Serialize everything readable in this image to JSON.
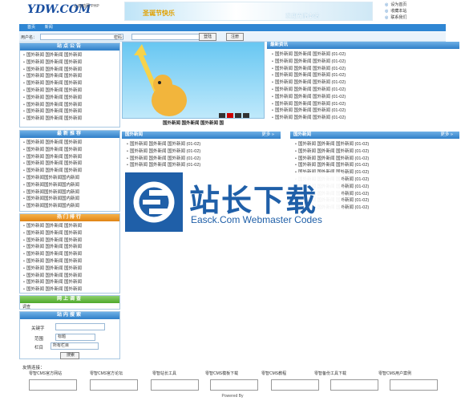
{
  "header": {
    "logo_main": "YDW.COM",
    "logo_sub": "心雨动网 PHP",
    "banner_text": "圣诞节快乐",
    "banner_sub": "欢迎光临本站",
    "links": [
      "设为首页",
      "收藏本站",
      "联系我们"
    ]
  },
  "nav": {
    "items": [
      "首页",
      "新闻"
    ]
  },
  "login": {
    "user_label": "用户名：",
    "pass_label": "密码：",
    "login_btn": "登陆",
    "register_btn": "注册"
  },
  "left": {
    "announce_title": "站点公告",
    "announce_items": [
      "国外新闻 国外新闻 国外新闻",
      "国外新闻 国外新闻 国外新闻",
      "国外新闻 国外新闻 国外新闻",
      "国外新闻 国外新闻 国外新闻",
      "国外新闻 国外新闻 国外新闻",
      "国外新闻 国外新闻 国外新闻",
      "国外新闻 国外新闻 国外新闻",
      "国外新闻 国外新闻 国外新闻",
      "国外新闻 国外新闻 国外新闻",
      "国外新闻 国外新闻 国外新闻"
    ],
    "recommend_title": "最新推荐",
    "recommend_items": [
      "国外新闻 国外新闻 国外新闻",
      "国外新闻 国外新闻 国外新闻",
      "国外新闻 国外新闻 国外新闻",
      "国外新闻 国外新闻 国外新闻",
      "国外新闻 国外新闻 国外新闻",
      "国外新闻国外新闻国内新闻",
      "国外新闻国外新闻国内新闻",
      "国外新闻国外新闻国内新闻",
      "国外新闻国外新闻国内新闻",
      "国外新闻国外新闻国内新闻"
    ],
    "hot_title": "热门排行",
    "hot_items": [
      "国外新闻 国外新闻 国外新闻",
      "国外新闻 国外新闻 国外新闻",
      "国外新闻 国外新闻 国外新闻",
      "国外新闻 国外新闻 国外新闻",
      "国外新闻 国外新闻 国外新闻",
      "国外新闻 国外新闻 国外新闻",
      "国外新闻 国外新闻 国外新闻",
      "国外新闻 国外新闻 国外新闻",
      "国外新闻 国外新闻 国外新闻",
      "国外新闻 国外新闻 国外新闻"
    ],
    "online_title": "网上调查",
    "online_text": "调查",
    "search_title": "站内搜索",
    "keyword_label": "关键字",
    "range_label": "范围",
    "range_value": "标题",
    "column_label": "栏目",
    "column_value": "所有栏目",
    "search_btn": "搜索"
  },
  "flash": {
    "caption": "国外新闻 国外新闻 国外新闻 国"
  },
  "latest": {
    "title": "最新资讯",
    "items": [
      "国外新闻 国外新闻 国外新闻 (01-02)",
      "国外新闻 国外新闻 国外新闻 (01-02)",
      "国外新闻 国外新闻 国外新闻 (01-02)",
      "国外新闻 国外新闻 国外新闻 (01-02)",
      "国外新闻 国外新闻 国外新闻 (01-02)",
      "国外新闻 国外新闻 国外新闻 (01-02)",
      "国外新闻 国外新闻 国外新闻 (01-02)",
      "国外新闻 国外新闻 国外新闻 (01-02)",
      "国外新闻 国外新闻 国外新闻 (01-02)",
      "国外新闻 国外新闻 国外新闻 (01-02)"
    ]
  },
  "panel_a": {
    "title": "国外新闻",
    "more": "更多 »",
    "items": [
      "国外新闻 国外新闻 国外新闻 (01-02)",
      "国外新闻 国外新闻 国外新闻 (01-02)",
      "国外新闻 国外新闻 国外新闻 (01-02)",
      "国外新闻 国外新闻 国外新闻 (01-02)"
    ]
  },
  "panel_b": {
    "title": "国外新闻",
    "more": "更多 »",
    "items": [
      "国外新闻 国外新闻 国外新闻 (01-02)",
      "国外新闻 国外新闻 国外新闻 (01-02)",
      "国外新闻 国外新闻 国外新闻 (01-02)",
      "国外新闻 国外新闻 国外新闻 (01-02)",
      "国外新闻 国外新闻 国外新闻 (01-02)",
      "国外新闻 国外新闻 国外新闻 (01-02)",
      "国外新闻 国外新闻 国外新闻 (01-02)",
      "国外新闻 国外新闻 国外新闻 (01-02)",
      "国外新闻 国外新闻 国外新闻 (01-02)",
      "国外新闻 国外新闻 国外新闻 (01-02)"
    ]
  },
  "watermark": {
    "title": "站长下载",
    "subtitle": "Easck.Com Webmaster Codes"
  },
  "friends": {
    "label": "友情连接：",
    "links": [
      "零智CMS官方网站",
      "零智CMS官方论坛",
      "零智站长工具",
      "零智CMS模板下载",
      "零智CMS教程",
      "零智备份工具下载",
      "零智CMS用户案例"
    ]
  },
  "footer": {
    "text": "Powered By"
  },
  "colors": {
    "nav_blue": "#2f86d3",
    "title_orange": "#e08414",
    "title_green": "#4ea92c",
    "brand_blue": "#1f5fa8"
  }
}
